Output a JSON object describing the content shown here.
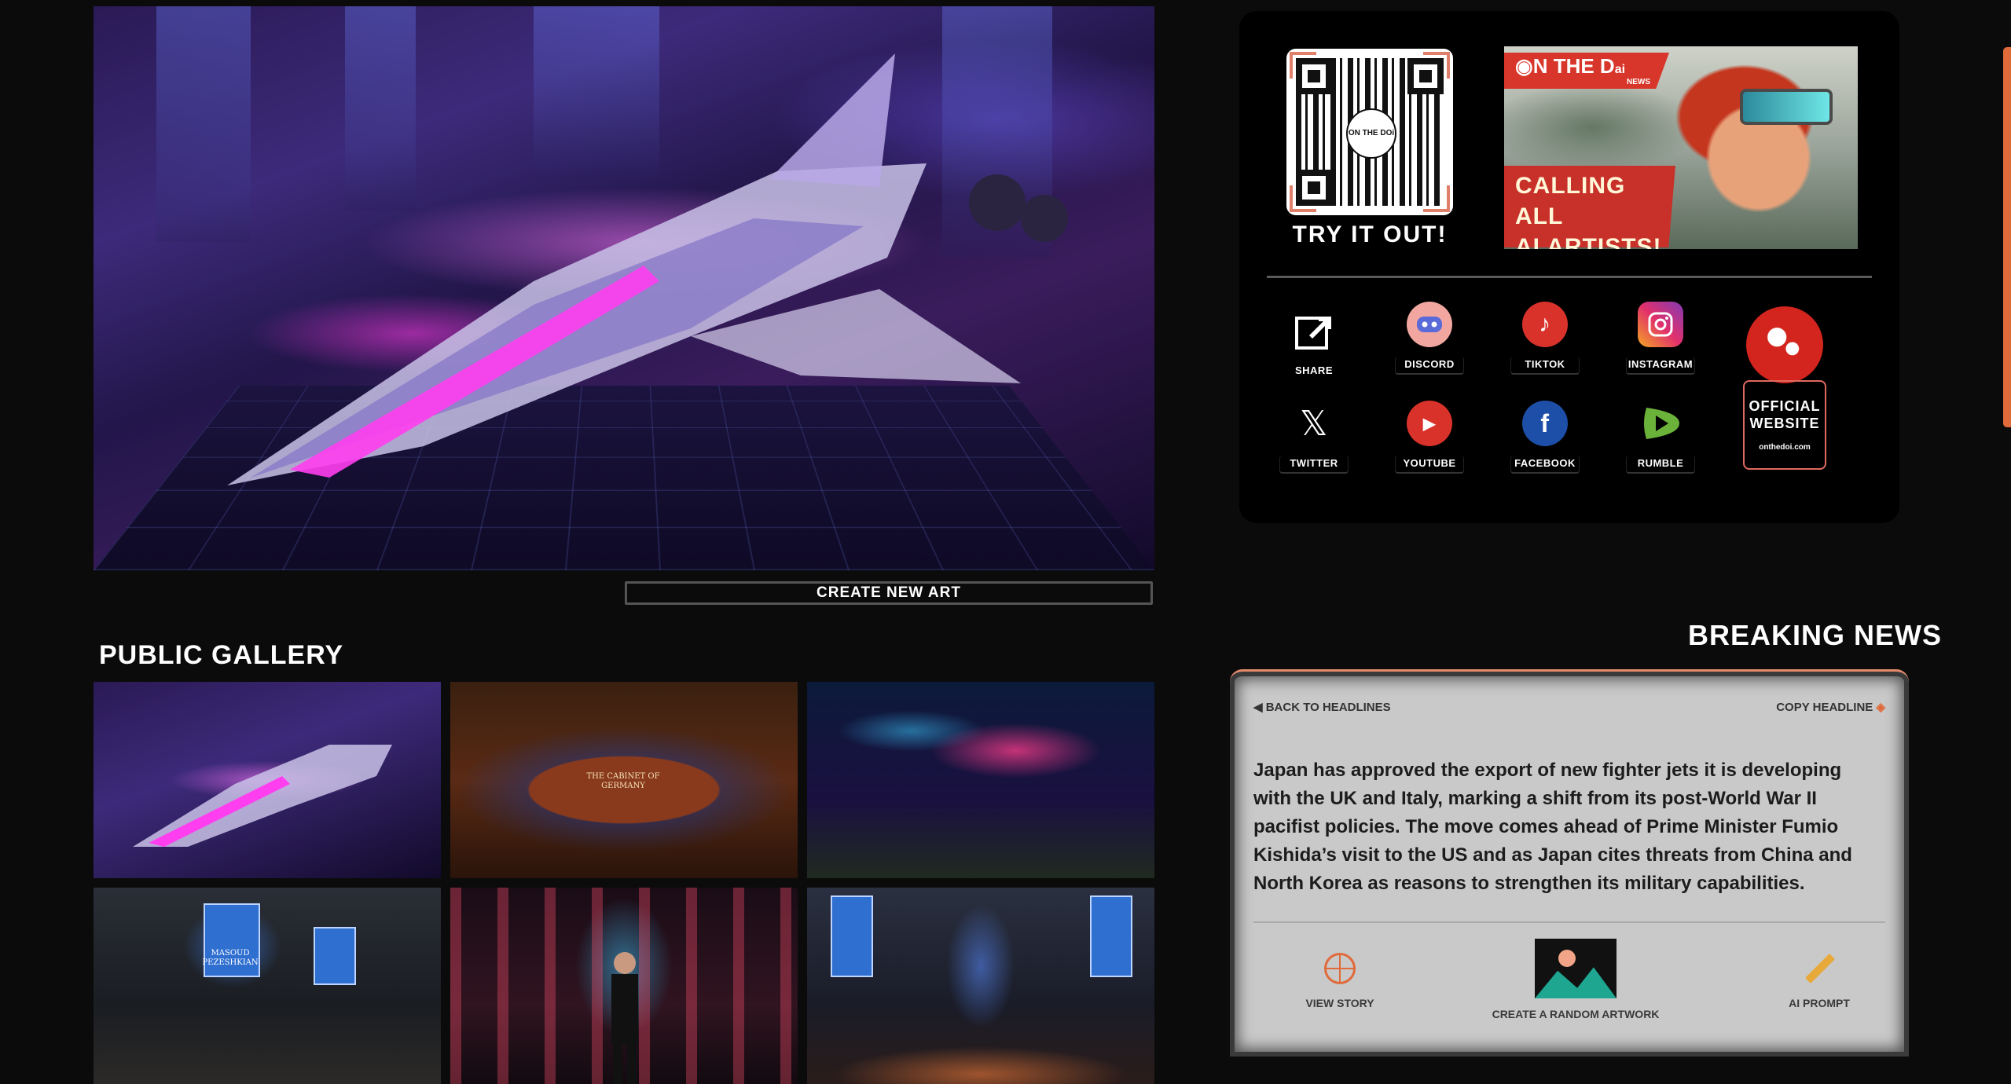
{
  "hero": {
    "image": "ai-generated-spaceship-artwork"
  },
  "create_button": {
    "label": "CREATE NEW ART"
  },
  "gallery": {
    "title": "PUBLIC GALLERY",
    "cabinet_caption": "THE CABINET OF GERMANY",
    "poster_caption": "MASOUD PEZESHKIAN"
  },
  "promo": {
    "try_label": "TRY IT OUT!",
    "qr_center": "ON THE DOi",
    "banner_brand": "N THE D",
    "banner_brand_ai": "ai",
    "banner_brand_sub": "NEWS",
    "banner_line1": "CALLING ALL",
    "banner_line2": "AI ARTISTS!"
  },
  "social": [
    {
      "label": "SHARE",
      "icon": "share-icon",
      "color": "#000000"
    },
    {
      "label": "DISCORD",
      "icon": "discord-icon",
      "color": "#f1a7a0"
    },
    {
      "label": "TIKTOK",
      "icon": "tiktok-icon",
      "color": "#d9322a"
    },
    {
      "label": "INSTAGRAM",
      "icon": "instagram-icon",
      "color": "#c13584"
    },
    {
      "label": "TWITTER",
      "icon": "x-icon",
      "color": "#000000"
    },
    {
      "label": "YOUTUBE",
      "icon": "youtube-icon",
      "color": "#d9322a"
    },
    {
      "label": "FACEBOOK",
      "icon": "facebook-icon",
      "color": "#1e4fa8"
    },
    {
      "label": "RUMBLE",
      "icon": "rumble-icon",
      "color": "#6bb23a"
    }
  ],
  "official": {
    "line1": "OFFICIAL",
    "line2": "WEBSITE",
    "url": "onthedoi.com"
  },
  "news": {
    "title": "BREAKING NEWS",
    "back_label": "BACK TO HEADLINES",
    "copy_label": "COPY HEADLINE",
    "headline": "Japan has approved the export of new fighter jets it is developing with the UK and Italy, marking a shift from its post-World War II pacifist policies. The move comes ahead of Prime Minister Fumio Kishida’s visit to the US and as Japan cites threats from China and North Korea as reasons to strengthen its military capabilities.",
    "actions": {
      "view_story": "VIEW STORY",
      "random_art": "CREATE A RANDOM ARTWORK",
      "ai_prompt": "AI PROMPT"
    }
  }
}
